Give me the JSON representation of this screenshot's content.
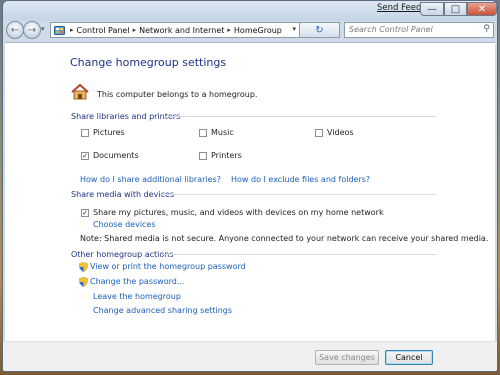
{
  "titlebar": {
    "feedback_label": "Send Feedback"
  },
  "address": {
    "crumbs": [
      "Control Panel",
      "Network and Internet",
      "HomeGroup"
    ],
    "search_placeholder": "Search Control Panel"
  },
  "page": {
    "title": "Change homegroup settings",
    "belongs_text": "This computer belongs to a homegroup."
  },
  "share_libraries": {
    "heading": "Share libraries and printers",
    "items": [
      {
        "label": "Pictures",
        "checked": false
      },
      {
        "label": "Music",
        "checked": false
      },
      {
        "label": "Videos",
        "checked": false
      },
      {
        "label": "Documents",
        "checked": true
      },
      {
        "label": "Printers",
        "checked": false
      }
    ],
    "link_share_additional": "How do I share additional libraries?",
    "link_exclude": "How do I exclude files and folders?"
  },
  "share_media": {
    "heading": "Share media with devices",
    "checkbox_label": "Share my pictures, music, and videos with devices on my home network",
    "checked": true,
    "choose_devices": "Choose devices",
    "note": "Note: Shared media is not secure. Anyone connected to your network can receive your shared media."
  },
  "other_actions": {
    "heading": "Other homegroup actions",
    "links": [
      "View or print the homegroup password",
      "Change the password...",
      "Leave the homegroup",
      "Change advanced sharing settings"
    ]
  },
  "footer": {
    "save_label": "Save changes",
    "cancel_label": "Cancel"
  },
  "icons": {
    "home": "homegroup-icon",
    "shield": "uac-shield-icon",
    "search": "search-icon",
    "refresh": "refresh-icon"
  }
}
